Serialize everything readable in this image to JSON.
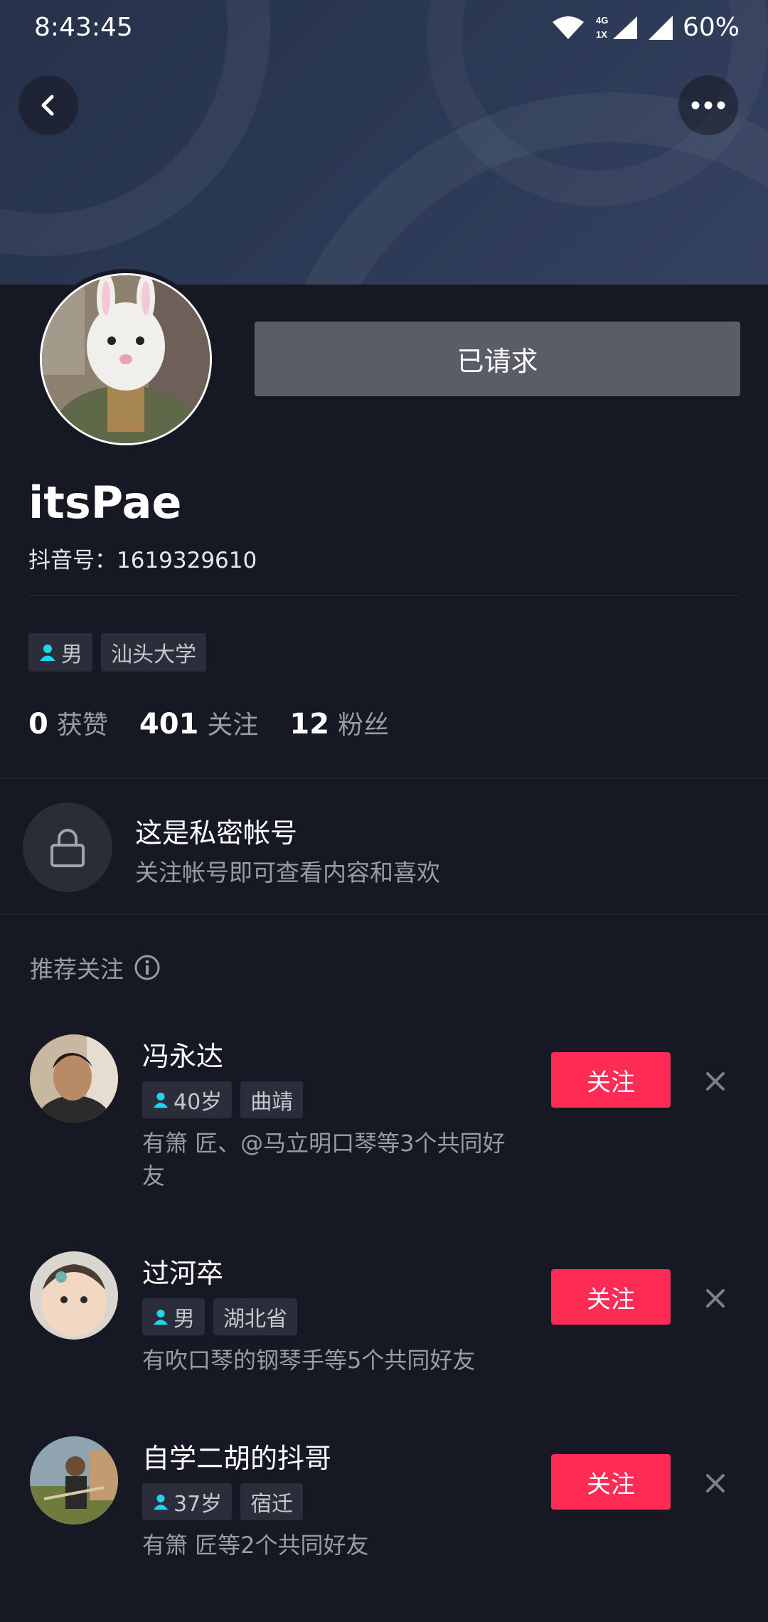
{
  "status_bar": {
    "time": "8:43:45",
    "network": "4G 1X",
    "battery": "60%"
  },
  "profile": {
    "button_label": "已请求",
    "username": "itsPae",
    "douyin_id": "抖音号：1619329610",
    "tags": {
      "gender": "男",
      "school": "汕头大学"
    },
    "stats": {
      "likes_num": "0",
      "likes_label": "获赞",
      "following_num": "401",
      "following_label": "关注",
      "fans_num": "12",
      "fans_label": "粉丝"
    }
  },
  "private": {
    "title": "这是私密帐号",
    "subtitle": "关注帐号即可查看内容和喜欢"
  },
  "recommend": {
    "header": "推荐关注",
    "items": [
      {
        "name": "冯永达",
        "tag1": "40岁",
        "tag2": "曲靖",
        "mutual": "有箫 匠、@马立明口琴等3个共同好友",
        "button": "关注"
      },
      {
        "name": "过河卒",
        "tag1": "男",
        "tag2": "湖北省",
        "mutual": "有吹口琴的钢琴手等5个共同好友",
        "button": "关注"
      },
      {
        "name": "自学二胡的抖哥",
        "tag1": "37岁",
        "tag2": "宿迁",
        "mutual": "有箫 匠等2个共同好友",
        "button": "关注"
      }
    ]
  },
  "colors": {
    "background": "#161823",
    "accent": "#fe2c55",
    "gender_icon": "#20d5ec",
    "requested_button": "#5b5d66"
  },
  "icons": [
    "back-icon",
    "more-icon",
    "wifi-icon",
    "signal-icon",
    "lock-icon",
    "info-icon",
    "person-icon",
    "close-icon"
  ]
}
